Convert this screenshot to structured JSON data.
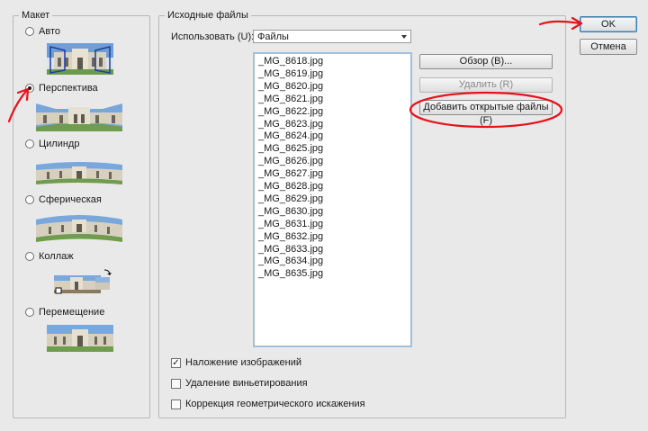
{
  "layout_group": {
    "legend": "Макет",
    "options": [
      {
        "label": "Авто",
        "selected": false
      },
      {
        "label": "Перспектива",
        "selected": true
      },
      {
        "label": "Цилиндр",
        "selected": false
      },
      {
        "label": "Сферическая",
        "selected": false
      },
      {
        "label": "Коллаж",
        "selected": false
      },
      {
        "label": "Перемещение",
        "selected": false
      }
    ]
  },
  "source_group": {
    "legend": "Исходные файлы",
    "use_label": "Использовать (U):",
    "use_value": "Файлы",
    "files": [
      "_MG_8618.jpg",
      "_MG_8619.jpg",
      "_MG_8620.jpg",
      "_MG_8621.jpg",
      "_MG_8622.jpg",
      "_MG_8623.jpg",
      "_MG_8624.jpg",
      "_MG_8625.jpg",
      "_MG_8626.jpg",
      "_MG_8627.jpg",
      "_MG_8628.jpg",
      "_MG_8629.jpg",
      "_MG_8630.jpg",
      "_MG_8631.jpg",
      "_MG_8632.jpg",
      "_MG_8633.jpg",
      "_MG_8634.jpg",
      "_MG_8635.jpg"
    ],
    "browse_label": "Обзор (B)...",
    "remove_label": "Удалить (R)",
    "add_open_label": "Добавить открытые файлы (F)"
  },
  "options": {
    "blend_label": "Наложение изображений",
    "blend_checked": true,
    "vignette_label": "Удаление виньетирования",
    "vignette_checked": false,
    "distortion_label": "Коррекция геометрического искажения",
    "distortion_checked": false
  },
  "dialog_buttons": {
    "ok_label": "OK",
    "cancel_label": "Отмена"
  },
  "colors": {
    "annotation_red": "#e8121a",
    "list_border": "#9fc0de",
    "background": "#e9e9e9"
  }
}
